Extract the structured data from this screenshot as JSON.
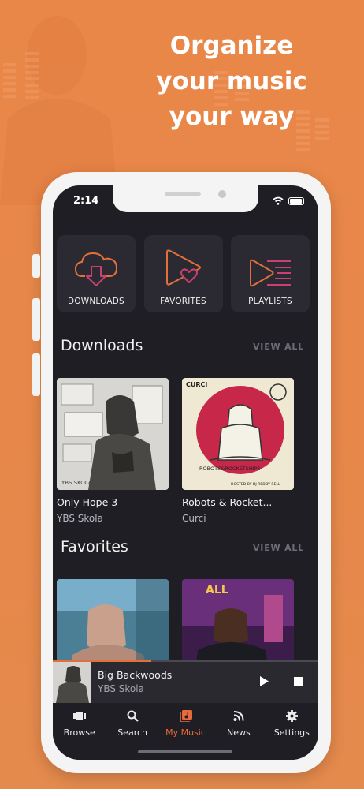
{
  "headline": [
    "Organize",
    "your music",
    "your way"
  ],
  "status_bar": {
    "time": "2:14"
  },
  "categories": [
    {
      "label": "DOWNLOADS",
      "icon": "cloud-download-icon"
    },
    {
      "label": "FAVORITES",
      "icon": "play-heart-icon"
    },
    {
      "label": "PLAYLISTS",
      "icon": "play-list-icon"
    }
  ],
  "sections": {
    "downloads": {
      "title": "Downloads",
      "view_all": "VIEW ALL"
    },
    "favorites": {
      "title": "Favorites",
      "view_all": "VIEW ALL"
    }
  },
  "downloads": [
    {
      "title": "Only Hope 3",
      "artist": "YBS Skola",
      "cover_text": "YBS SKOLA"
    },
    {
      "title": "Robots & Rocket...",
      "artist": "Curci",
      "cover_text": "CURCI",
      "cover_subtitle": "ROBOTS&ROCKETSHIPS",
      "cover_footer": "HOSTED BY DJ REDDY RELL"
    }
  ],
  "now_playing": {
    "title": "Big Backwoods",
    "artist": "YBS Skola",
    "progress": 0.37
  },
  "tabs": [
    {
      "label": "Browse",
      "icon": "browse-icon",
      "active": false
    },
    {
      "label": "Search",
      "icon": "search-icon",
      "active": false
    },
    {
      "label": "My Music",
      "icon": "my-music-icon",
      "active": true
    },
    {
      "label": "News",
      "icon": "rss-icon",
      "active": false
    },
    {
      "label": "Settings",
      "icon": "gear-icon",
      "active": false
    }
  ],
  "colors": {
    "accent": "#e8693a",
    "icon_orange": "#e46f3b",
    "icon_pink": "#c9426f",
    "background": "#e98748",
    "screen": "#1f1e24"
  }
}
